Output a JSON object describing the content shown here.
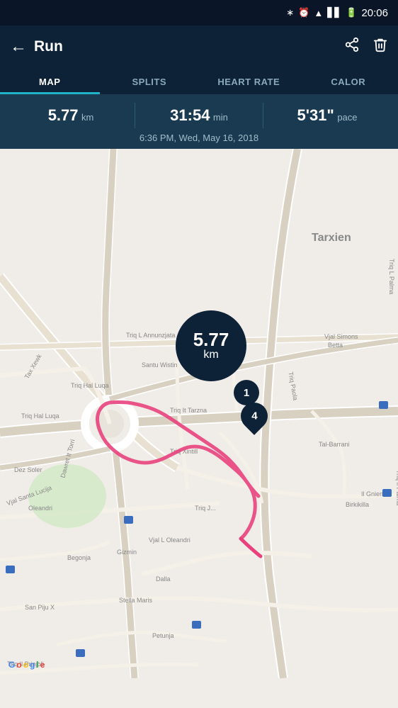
{
  "statusBar": {
    "time": "20:06",
    "icons": [
      "bluetooth",
      "alarm",
      "wifi",
      "signal",
      "battery"
    ]
  },
  "topBar": {
    "title": "Run",
    "backLabel": "←",
    "shareLabel": "⬆",
    "deleteLabel": "🗑"
  },
  "tabs": [
    {
      "id": "map",
      "label": "MAP",
      "active": true
    },
    {
      "id": "splits",
      "label": "SPLITS",
      "active": false
    },
    {
      "id": "heart-rate",
      "label": "HEART RATE",
      "active": false
    },
    {
      "id": "calories",
      "label": "CALOR",
      "active": false
    }
  ],
  "stats": {
    "distance": "5.77",
    "distance_unit": "km",
    "duration": "31:54",
    "duration_unit": "min",
    "pace": "5'31\"",
    "pace_unit": "pace",
    "date": "6:36 PM, Wed, May 16, 2018"
  },
  "map": {
    "distanceBubble": {
      "value": "5.77",
      "unit": "km"
    },
    "markers": [
      {
        "id": "1",
        "label": "1"
      },
      {
        "id": "4",
        "label": "4"
      }
    ],
    "google_attr": "Google"
  }
}
